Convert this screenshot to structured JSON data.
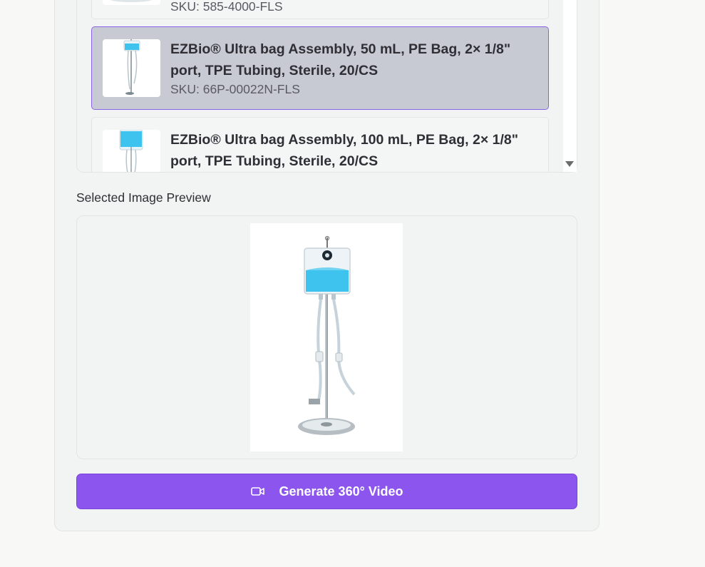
{
  "product_list": {
    "items": [
      {
        "title": "",
        "sku": "SKU: 585-4000-FLS",
        "selected": false
      },
      {
        "title": "EZBio® Ultra bag Assembly, 50 mL, PE Bag, 2× 1/8\" port, TPE Tubing, Sterile, 20/CS",
        "sku": "SKU: 66P-00022N-FLS",
        "selected": true
      },
      {
        "title": "EZBio® Ultra bag Assembly, 100 mL, PE Bag, 2× 1/8\" port, TPE Tubing, Sterile, 20/CS",
        "sku": "",
        "selected": false
      }
    ]
  },
  "preview": {
    "label": "Selected Image Preview"
  },
  "generate_button": {
    "label": "Generate 360° Video",
    "icon": "video-camera-icon"
  },
  "colors": {
    "accent": "#8b55ee",
    "selected_bg": "#c7cad3",
    "selected_border": "#8b63e8",
    "liquid": "#3ec3ee"
  }
}
